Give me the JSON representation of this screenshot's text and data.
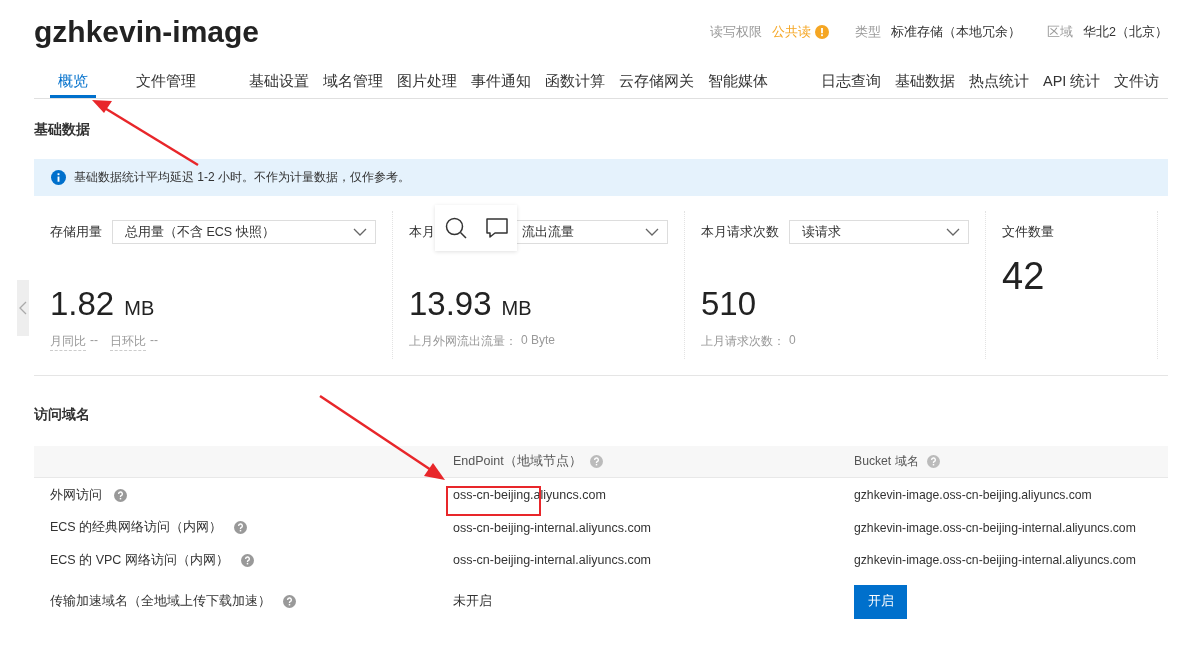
{
  "header": {
    "title": "gzhkevin-image",
    "meta": [
      {
        "label": "读写权限",
        "value": "公共读",
        "warning": true
      },
      {
        "label": "类型",
        "value": "标准存储（本地冗余）",
        "warning": false
      },
      {
        "label": "区域",
        "value": "华北2（北京）",
        "warning": false
      }
    ]
  },
  "tab_groups": [
    {
      "tabs": [
        {
          "label": "概览",
          "selected": true
        }
      ]
    },
    {
      "tabs": [
        {
          "label": "文件管理",
          "selected": false
        }
      ]
    },
    {
      "tabs": [
        {
          "label": "基础设置",
          "selected": false
        },
        {
          "label": "域名管理",
          "selected": false
        },
        {
          "label": "图片处理",
          "selected": false
        },
        {
          "label": "事件通知",
          "selected": false
        },
        {
          "label": "函数计算",
          "selected": false
        },
        {
          "label": "云存储网关",
          "selected": false
        },
        {
          "label": "智能媒体",
          "selected": false
        }
      ]
    },
    {
      "tabs": [
        {
          "label": "日志查询",
          "selected": false
        },
        {
          "label": "基础数据",
          "selected": false
        },
        {
          "label": "热点统计",
          "selected": false
        },
        {
          "label": "API 统计",
          "selected": false
        },
        {
          "label": "文件访",
          "selected": false
        }
      ]
    }
  ],
  "basic_data": {
    "title": "基础数据",
    "notice": "基础数据统计平均延迟 1-2 小时。不作为计量数据，仅作参考。",
    "cards": [
      {
        "label": "存储用量",
        "select": "总用量（不含 ECS 快照）",
        "value": "1.82",
        "unit": "MB",
        "footer": [
          {
            "label": "月同比",
            "value": "--"
          },
          {
            "label": "日环比",
            "value": "--"
          }
        ]
      },
      {
        "label": "本月",
        "select": "流出流量",
        "value": "13.93",
        "unit": "MB",
        "footer": [
          {
            "label": "上月外网流出流量：",
            "value": "0 Byte"
          }
        ]
      },
      {
        "label": "本月请求次数",
        "select": "读请求",
        "value": "510",
        "footer": [
          {
            "label": "上月请求次数：",
            "value": "0"
          }
        ]
      },
      {
        "label": "文件数量",
        "value": "42"
      }
    ]
  },
  "domains": {
    "title": "访问域名",
    "columns": [
      {
        "label": "EndPoint（地域节点）",
        "help": true
      },
      {
        "label": "Bucket 域名",
        "help": true
      }
    ],
    "rows": [
      {
        "kind": "text",
        "name": "外网访问",
        "help": true,
        "endpoint": "oss-cn-beijing.aliyuncs.com",
        "bucket": "gzhkevin-image.oss-cn-beijing.aliyuncs.com"
      },
      {
        "kind": "text",
        "name": "ECS 的经典网络访问（内网）",
        "help": true,
        "endpoint": "oss-cn-beijing-internal.aliyuncs.com",
        "bucket": "gzhkevin-image.oss-cn-beijing-internal.aliyuncs.com"
      },
      {
        "kind": "text",
        "name": "ECS 的 VPC 网络访问（内网）",
        "help": true,
        "endpoint": "oss-cn-beijing-internal.aliyuncs.com",
        "bucket": "gzhkevin-image.oss-cn-beijing-internal.aliyuncs.com"
      },
      {
        "kind": "action",
        "name": "传输加速域名（全地域上传下载加速）",
        "help": true,
        "endpoint": "未开启",
        "action": "开启"
      }
    ]
  }
}
